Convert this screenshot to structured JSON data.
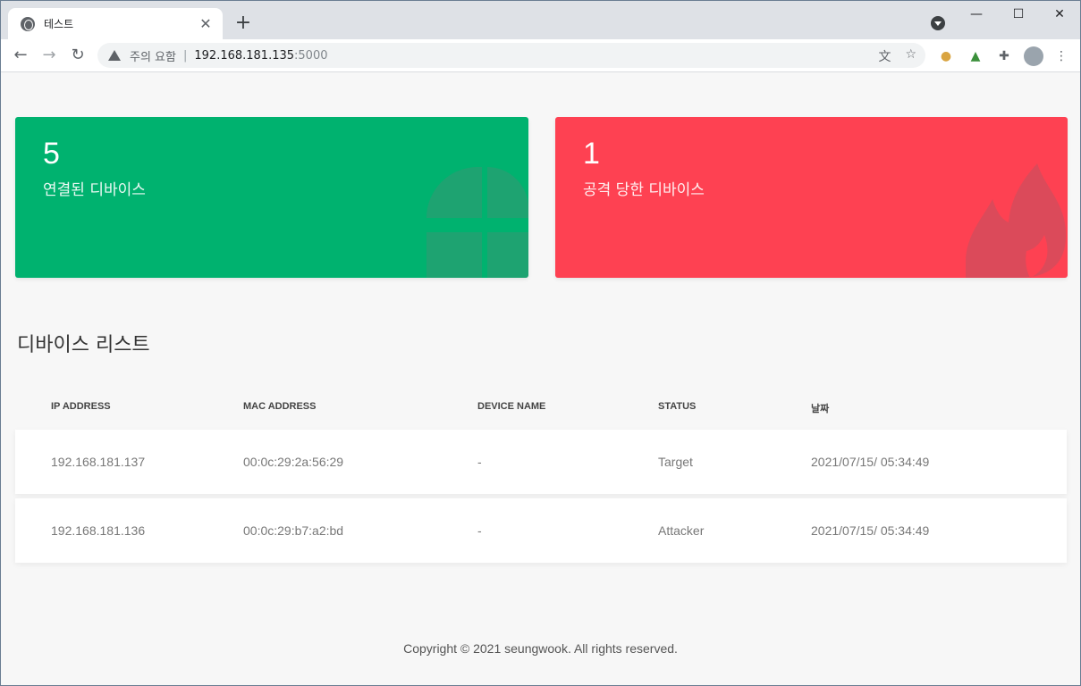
{
  "browser": {
    "tab_title": "테스트",
    "tab_close": "✕",
    "new_tab": "+",
    "minimize": "—",
    "maximize": "☐",
    "close": "✕",
    "back": "←",
    "forward": "→",
    "reload": "↻",
    "address": {
      "warning_label": "주의 요함",
      "separator": "|",
      "host": "192.168.181.135",
      "port": ":5000"
    },
    "translate_icon": "文",
    "bookmark_icon": "☆",
    "extensions_icon": "✚",
    "menu_icon": "⋮",
    "cookie_icon": "●"
  },
  "cards": {
    "connected": {
      "count": "5",
      "label": "연결된 디바이스",
      "color": "#00b26f"
    },
    "attacked": {
      "count": "1",
      "label": "공격 당한 디바이스",
      "color": "#fe4152"
    }
  },
  "device_list": {
    "title": "디바이스 리스트",
    "columns": [
      "IP ADDRESS",
      "MAC ADDRESS",
      "DEVICE NAME",
      "STATUS",
      "날짜"
    ],
    "rows": [
      {
        "ip": "192.168.181.137",
        "mac": "00:0c:29:2a:56:29",
        "name": "-",
        "status": "Target",
        "date": "2021/07/15/ 05:34:49"
      },
      {
        "ip": "192.168.181.136",
        "mac": "00:0c:29:b7:a2:bd",
        "name": "-",
        "status": "Attacker",
        "date": "2021/07/15/ 05:34:49"
      }
    ]
  },
  "footer": "Copyright © 2021 seungwook. All rights reserved."
}
